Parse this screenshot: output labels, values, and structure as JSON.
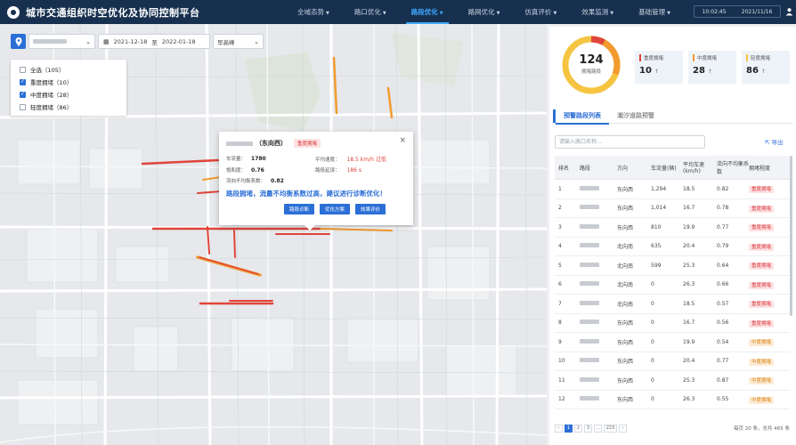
{
  "header": {
    "title": "城市交通组织时空优化及协同控制平台",
    "nav": [
      {
        "label": "全域态势",
        "active": false
      },
      {
        "label": "路口优化",
        "active": false
      },
      {
        "label": "路段优化",
        "active": true
      },
      {
        "label": "路网优化",
        "active": false
      },
      {
        "label": "仿真评价",
        "active": false
      },
      {
        "label": "效果监测",
        "active": false
      },
      {
        "label": "基础管理",
        "active": false
      }
    ],
    "time": "10:02:45",
    "date": "2021/11/16"
  },
  "filters": {
    "date_start": "2021-12-18",
    "date_sep": "至",
    "date_end": "2022-01-18",
    "peak": "早高峰"
  },
  "legend": [
    {
      "label": "全选（105）",
      "checked": false
    },
    {
      "label": "重度拥堵（10）",
      "checked": true
    },
    {
      "label": "中度拥堵（28）",
      "checked": true
    },
    {
      "label": "轻度拥堵（86）",
      "checked": false
    }
  ],
  "popup": {
    "direction": "（东向西）",
    "tag": "重度拥堵",
    "flow_label": "车流量：",
    "flow_value": "1780",
    "speed_label": "平均速度：",
    "speed_value": "18.5 km/h 过低",
    "saturation_label": "饱和度：",
    "saturation_value": "0.76",
    "queue_label": "路段延误：",
    "queue_value": "186 s",
    "imbalance_label": "流向不均衡系数：",
    "imbalance_value": "0.82",
    "alert": "路段拥堵，流量不均衡系数过高，建议进行诊断优化！",
    "buttons": [
      "路段诊断",
      "优化方案",
      "效果评价"
    ],
    "close": "×"
  },
  "summary": {
    "total": "124",
    "total_label": "拥堵路段",
    "stats": [
      {
        "label": "重度拥堵",
        "value": "10",
        "arrow": "↑",
        "color": "#e0443a"
      },
      {
        "label": "中度拥堵",
        "value": "28",
        "arrow": "↑",
        "color": "#f29a2e"
      },
      {
        "label": "轻度拥堵",
        "value": "86",
        "arrow": "↑",
        "color": "#f5c542"
      }
    ]
  },
  "tabs": [
    {
      "label": "预警路段列表",
      "active": true
    },
    {
      "label": "潮汐道路预警",
      "active": false
    }
  ],
  "search_placeholder": "请输入路口名称...",
  "export_label": "导出",
  "table": {
    "headers": [
      "排名",
      "路段",
      "方向",
      "车流量(辆)",
      "平均车速(km/h)",
      "流向不均衡系数",
      "拥堵程度"
    ],
    "rows": [
      {
        "rank": "1",
        "dir": "东向西",
        "flow": "1,294",
        "speed": "18.5",
        "coef": "0.82",
        "level": "重度拥堵",
        "sev": "h"
      },
      {
        "rank": "2",
        "dir": "东向西",
        "flow": "1,014",
        "speed": "16.7",
        "coef": "0.78",
        "level": "重度拥堵",
        "sev": "h"
      },
      {
        "rank": "3",
        "dir": "东向西",
        "flow": "810",
        "speed": "19.9",
        "coef": "0.77",
        "level": "重度拥堵",
        "sev": "h"
      },
      {
        "rank": "4",
        "dir": "北向南",
        "flow": "635",
        "speed": "20.4",
        "coef": "0.79",
        "level": "重度拥堵",
        "sev": "h"
      },
      {
        "rank": "5",
        "dir": "北向南",
        "flow": "599",
        "speed": "25.3",
        "coef": "0.64",
        "level": "重度拥堵",
        "sev": "h"
      },
      {
        "rank": "6",
        "dir": "北向南",
        "flow": "0",
        "speed": "26.3",
        "coef": "0.66",
        "level": "重度拥堵",
        "sev": "h"
      },
      {
        "rank": "7",
        "dir": "北向南",
        "flow": "0",
        "speed": "18.5",
        "coef": "0.57",
        "level": "重度拥堵",
        "sev": "h"
      },
      {
        "rank": "8",
        "dir": "东向西",
        "flow": "0",
        "speed": "16.7",
        "coef": "0.56",
        "level": "重度拥堵",
        "sev": "h"
      },
      {
        "rank": "9",
        "dir": "东向西",
        "flow": "0",
        "speed": "19.9",
        "coef": "0.54",
        "level": "中度拥堵",
        "sev": "m"
      },
      {
        "rank": "10",
        "dir": "东向西",
        "flow": "0",
        "speed": "20.4",
        "coef": "0.77",
        "level": "中度拥堵",
        "sev": "m"
      },
      {
        "rank": "11",
        "dir": "东向西",
        "flow": "0",
        "speed": "25.3",
        "coef": "0.87",
        "level": "中度拥堵",
        "sev": "m"
      },
      {
        "rank": "12",
        "dir": "东向西",
        "flow": "0",
        "speed": "26.3",
        "coef": "0.55",
        "level": "中度拥堵",
        "sev": "m"
      }
    ]
  },
  "pager": {
    "prev": "‹",
    "pages": [
      "1",
      "2",
      "3",
      "...",
      "223"
    ],
    "next": "›",
    "info": "每页 20 条，总共 465 条"
  }
}
